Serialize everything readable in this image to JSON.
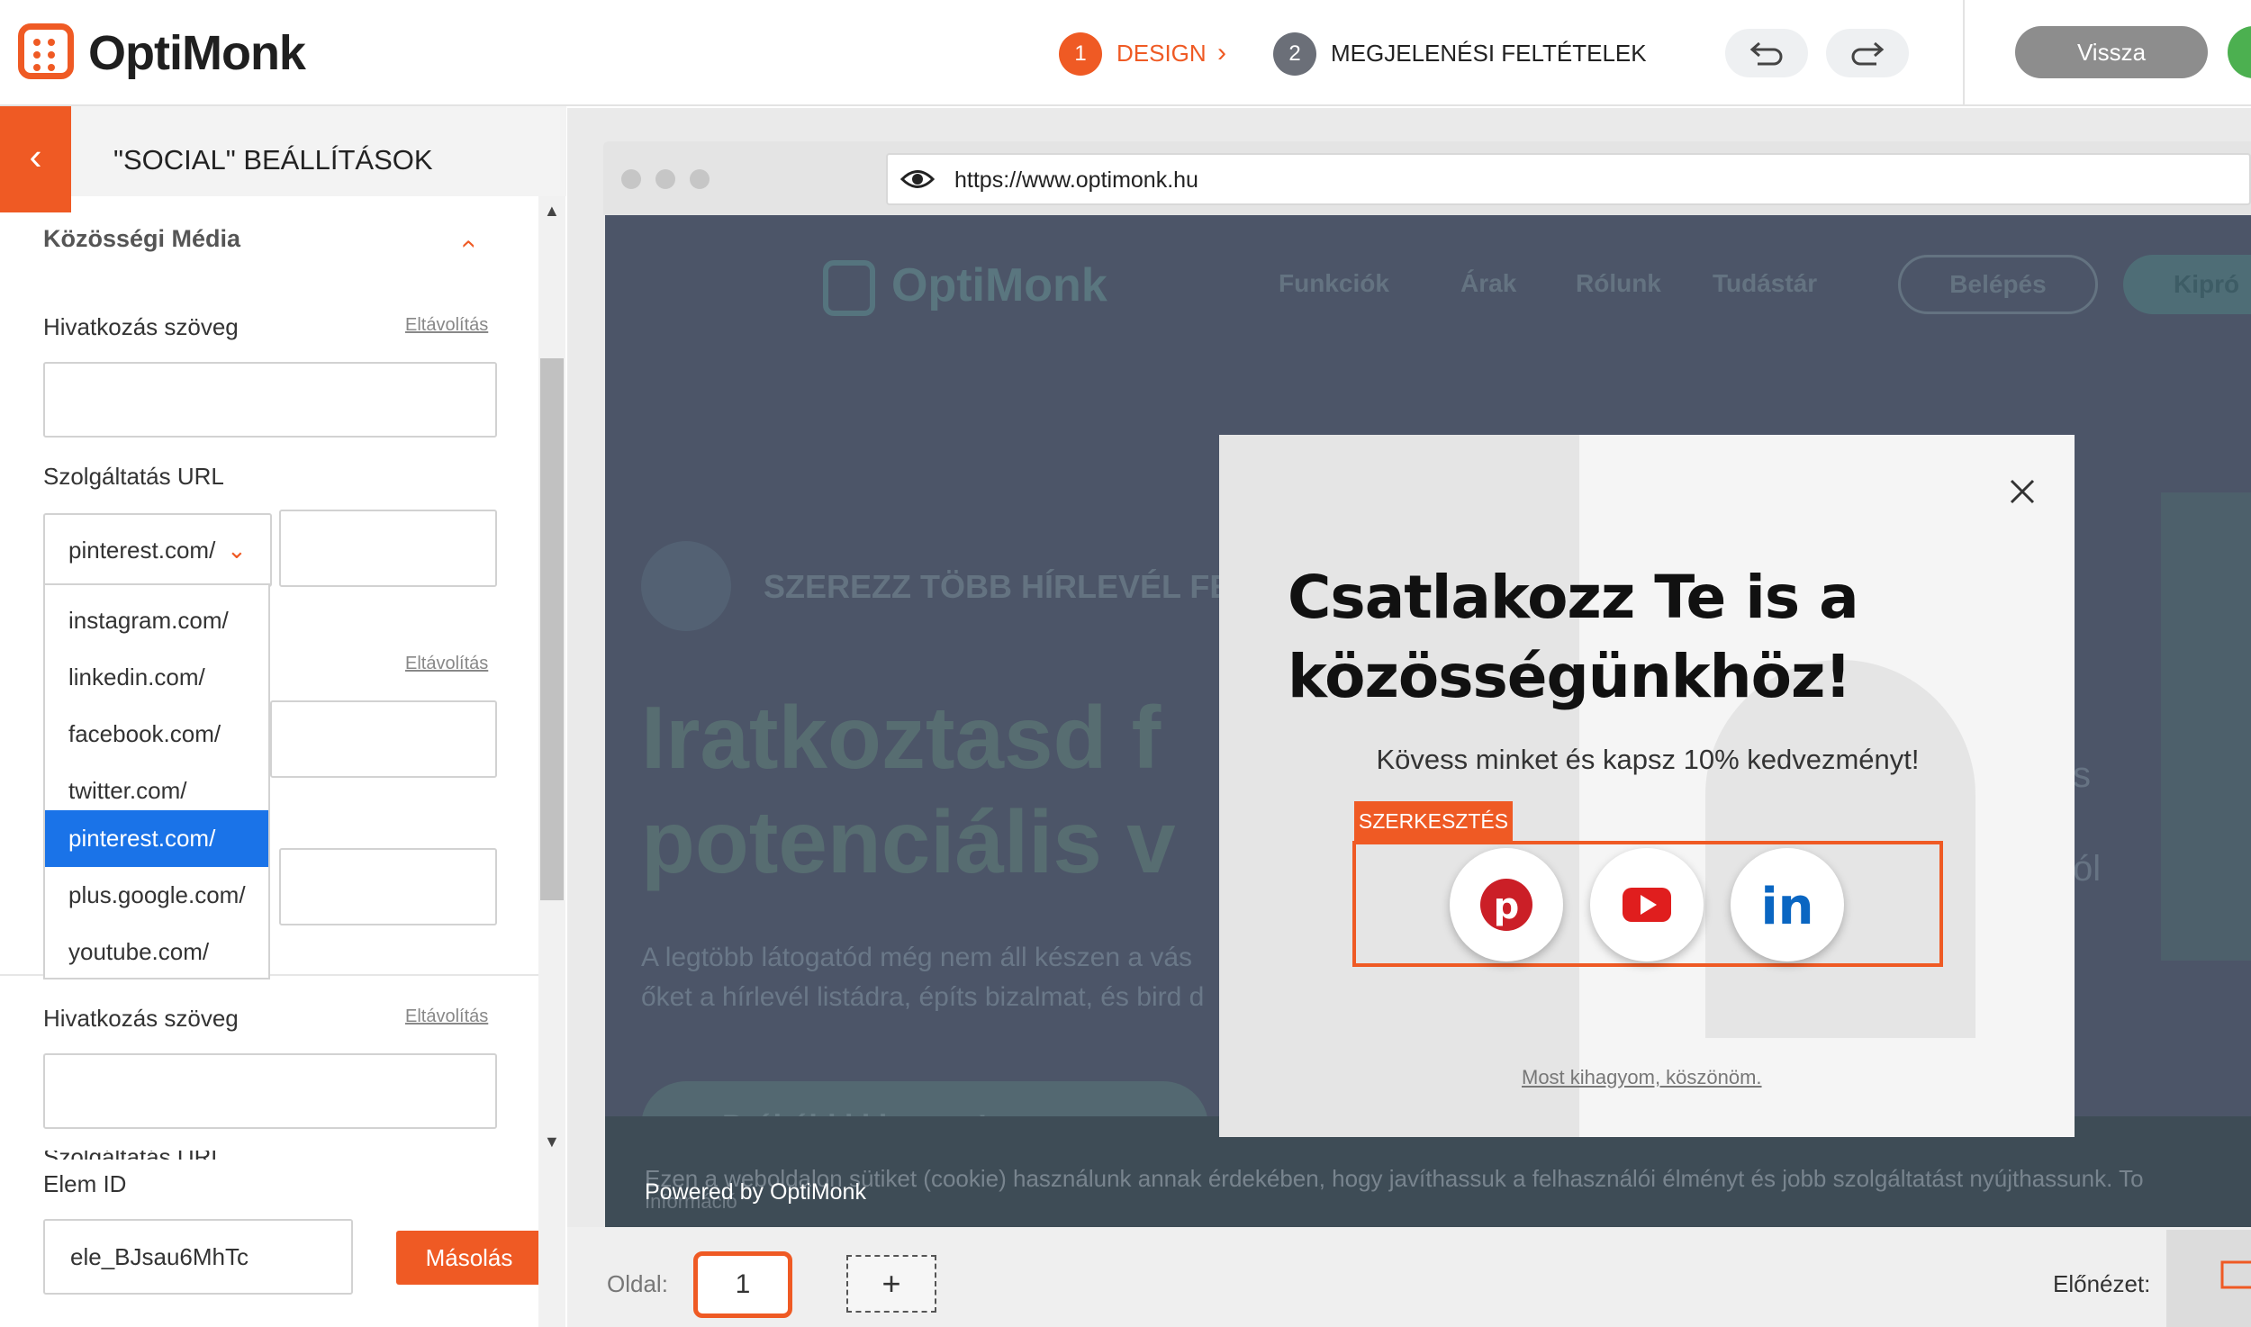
{
  "app": {
    "logo_text": "OptiMonk"
  },
  "steps": [
    {
      "number": "1",
      "label": "DESIGN",
      "color": "#ef5a24"
    },
    {
      "number": "2",
      "label": "MEGJELENÉSI FELTÉTELEK",
      "color": "#6b6f78"
    }
  ],
  "toolbar": {
    "back_label": "Vissza"
  },
  "panel": {
    "title": "\"SOCIAL\" BEÁLLÍTÁSOK",
    "section_title": "Közösségi Média",
    "link_text_label": "Hivatkozás szöveg",
    "remove_label": "Eltávolítás",
    "service_url_label": "Szolgáltatás URL",
    "service_url_label_cut": "Szolgáltatás URL",
    "selected_service": "pinterest.com/",
    "dropdown_options": [
      "instagram.com/",
      "linkedin.com/",
      "facebook.com/",
      "twitter.com/",
      "pinterest.com/",
      "plus.google.com/",
      "youtube.com/"
    ],
    "selected_index": 4,
    "element_id_label": "Elem ID",
    "element_id_value": "ele_BJsau6MhTc",
    "copy_label": "Másolás"
  },
  "browser": {
    "url": "https://www.optimonk.hu"
  },
  "site": {
    "logo_text": "OptiMonk",
    "nav": [
      "Funkciók",
      "Árak",
      "Rólunk",
      "Tudástár"
    ],
    "login_label": "Belépés",
    "try_label": "Kipró",
    "newsletter_banner": "SZEREZZ TÖBB HÍRLEVÉL FELIR",
    "hero_line1": "Iratkoztasd f",
    "hero_line2": "potenciális v",
    "body_line1": "A legtöbb látogatód még nem áll készen a vás",
    "body_line2": "őket a hírlevél listádra, építs bizalmat, és bird d",
    "cta_label": "Próbáld ki ingyen!",
    "cookie_text": "Ezen a weboldalon sütiket (cookie) használunk annak érdekében, hogy javíthassuk a felhasználói élményt és jobb szolgáltatást nyújthassunk. To",
    "cookie_text2": "Információ",
    "right_fragment1": "s",
    "right_fragment2": "ól",
    "powered_by": "Powered by OptiMonk"
  },
  "popup": {
    "headline_line1": "Csatlakozz Te is a",
    "headline_line2": "közösségünkhöz!",
    "subline": "Kövess minket és kapsz 10% kedvezményt!",
    "edit_tag": "SZERKESZTÉS",
    "social_icons": [
      "pinterest-icon",
      "youtube-icon",
      "linkedin-icon"
    ],
    "skip_label": "Most kihagyom, köszönöm."
  },
  "bottom": {
    "page_label": "Oldal:",
    "page_number": "1",
    "add_label": "+",
    "preview_label": "Előnézet:"
  },
  "colors": {
    "accent": "#ef5a24",
    "selected_option": "#1a73e8",
    "site_overlay": "#4c5568"
  }
}
